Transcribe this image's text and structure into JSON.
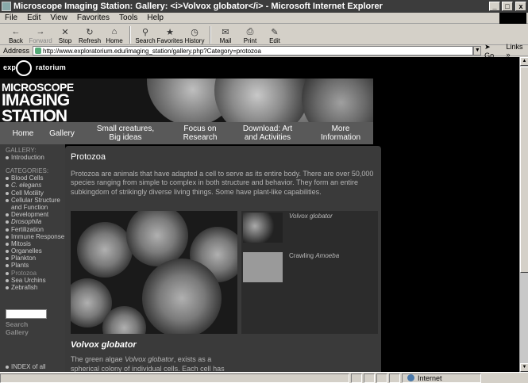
{
  "window": {
    "title": "Microscope Imaging Station: Gallery: <i>Volvox globator</i> - Microsoft Internet Explorer",
    "controls": [
      "_",
      "□",
      "x"
    ]
  },
  "menu": [
    "File",
    "Edit",
    "View",
    "Favorites",
    "Tools",
    "Help"
  ],
  "toolbar": [
    {
      "label": "Back",
      "icon": "back-arrow-icon",
      "disabled": false
    },
    {
      "label": "Forward",
      "icon": "forward-arrow-icon",
      "disabled": true
    },
    {
      "label": "Stop",
      "icon": "stop-icon",
      "disabled": false
    },
    {
      "label": "Refresh",
      "icon": "refresh-icon",
      "disabled": false
    },
    {
      "label": "Home",
      "icon": "home-icon",
      "disabled": false
    },
    {
      "label": "Search",
      "icon": "search-icon",
      "disabled": false
    },
    {
      "label": "Favorites",
      "icon": "favorites-icon",
      "disabled": false
    },
    {
      "label": "History",
      "icon": "history-icon",
      "disabled": false
    },
    {
      "label": "Mail",
      "icon": "mail-icon",
      "disabled": false
    },
    {
      "label": "Print",
      "icon": "print-icon",
      "disabled": false
    },
    {
      "label": "Edit",
      "icon": "edit-icon",
      "disabled": false
    }
  ],
  "address": {
    "label": "Address",
    "url": "http://www.exploratorium.edu/imaging_station/gallery.php?Category=protozoa",
    "go": "Go",
    "links": "Links"
  },
  "site": {
    "logo": {
      "left": "expl",
      "right": "ratorium"
    },
    "banner_title": {
      "line1": "MICROSCOPE",
      "line2": "IMAGING",
      "line3": "STATION"
    },
    "nav": {
      "home": "Home",
      "gallery": "Gallery",
      "small_line1": "Small creatures,",
      "small_line2": "Big ideas",
      "focus_line1": "Focus on",
      "focus_line2": "Research",
      "download_line1": "Download: Art",
      "download_line2": "and Activities",
      "more_line1": "More",
      "more_line2": "Information"
    }
  },
  "sidebar": {
    "gallery_header": "GALLERY:",
    "gallery_items": [
      "Introduction"
    ],
    "categories_header": "CATEGORIES:",
    "categories": [
      {
        "label": "Blood Cells"
      },
      {
        "label": "C. elegans",
        "italic": true
      },
      {
        "label": "Cell Motility"
      },
      {
        "label": "Cellular Structure and Function"
      },
      {
        "label": "Development"
      },
      {
        "label": "Drosophila",
        "italic": true
      },
      {
        "label": "Fertilization"
      },
      {
        "label": "Immune Response"
      },
      {
        "label": "Mitosis"
      },
      {
        "label": "Organelles"
      },
      {
        "label": "Plankton"
      },
      {
        "label": "Plants"
      },
      {
        "label": "Protozoa",
        "active": true
      },
      {
        "label": "Sea Urchins"
      },
      {
        "label": "Zebrafish"
      }
    ],
    "search_line1": "Search",
    "search_line2": "Gallery",
    "index_link": "INDEX of all"
  },
  "main": {
    "title": "Protozoa",
    "intro": "Protozoa are animals that have adapted a cell to serve as its entire body. There are over 50,000 species ranging from simple to complex in both structure and behavior. They form an entire subkingdom of strikingly diverse living things. Some have plant-like capabilities.",
    "thumbs": [
      {
        "label": "Volvox globator"
      },
      {
        "label_prefix": "Crawling ",
        "label_italic": "Amoeba"
      }
    ],
    "subtitle": "Volvox globator",
    "desc_prefix": "The green algae ",
    "desc_italic": "Volvox globator",
    "desc_suffix": ", exists as a",
    "desc_line2": "spherical colony of individual cells. Each cell has"
  },
  "status": {
    "zone": "Internet"
  }
}
